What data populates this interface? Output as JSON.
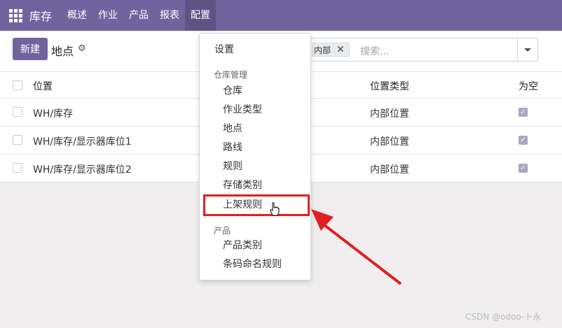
{
  "topbar": {
    "app_name": "库存",
    "menu": [
      "概述",
      "作业",
      "产品",
      "报表",
      "配置"
    ],
    "active_menu": "配置",
    "bg_color": "#71639e"
  },
  "controlpanel": {
    "new_button": "新建",
    "title": "地点",
    "gear_icon": "gear-icon",
    "search_facet": "内部",
    "search_placeholder": "搜索..."
  },
  "list": {
    "columns": [
      "位置",
      "位置类型",
      "为空"
    ],
    "rows": [
      {
        "location": "WH/库存",
        "type": "内部位置",
        "empty": true
      },
      {
        "location": "WH/库存/显示器库位1",
        "type": "内部位置",
        "empty": true
      },
      {
        "location": "WH/库存/显示器库位2",
        "type": "内部位置",
        "empty": true
      }
    ]
  },
  "dropdown": {
    "settings": "设置",
    "warehouse_header": "仓库管理",
    "warehouse_items": [
      "仓库",
      "作业类型",
      "地点",
      "路线",
      "规则",
      "存储类别",
      "上架规则"
    ],
    "product_header": "产品",
    "product_items": [
      "产品类别",
      "条码命名规则"
    ],
    "highlighted_item": "上架规则"
  },
  "annotation": {
    "highlight_color": "#e02020"
  },
  "watermark": "CSDN @odoo-卜永"
}
